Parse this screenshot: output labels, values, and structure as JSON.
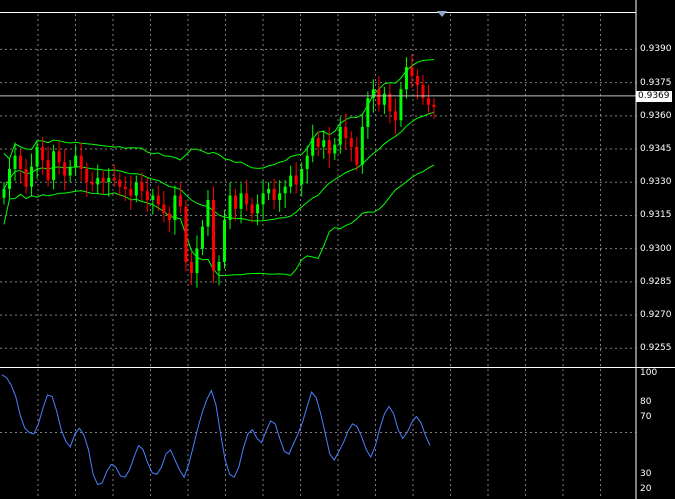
{
  "chart_data": [
    {
      "type": "candlestick",
      "indicators": [
        "bollinger-bands"
      ],
      "y_ticks": [
        "0.9390",
        "0.9375",
        "0.9360",
        "0.9345",
        "0.9330",
        "0.9315",
        "0.9300",
        "0.9285",
        "0.9270",
        "0.9255"
      ],
      "ylim": [
        0.9247,
        0.9406
      ],
      "current_price": "0.9369",
      "grid": true,
      "colors": {
        "bull": "#00ff00",
        "bear": "#ff0000",
        "bands": "#00ff00",
        "grid": "#7f7f7f",
        "price_line": "#c0c0c0"
      },
      "candles_close": [
        0.9327,
        0.9336,
        0.9342,
        0.9336,
        0.9328,
        0.9337,
        0.9346,
        0.934,
        0.9331,
        0.9344,
        0.9339,
        0.9333,
        0.9337,
        0.9342,
        0.9336,
        0.933,
        0.9329,
        0.9332,
        0.933,
        0.9332,
        0.9331,
        0.9328,
        0.9327,
        0.9324,
        0.933,
        0.9326,
        0.9322,
        0.9324,
        0.932,
        0.9316,
        0.9313,
        0.9324,
        0.9319,
        0.9294,
        0.9289,
        0.93,
        0.931,
        0.9322,
        0.929,
        0.9294,
        0.9313,
        0.9324,
        0.9318,
        0.9325,
        0.932,
        0.9316,
        0.932,
        0.9325,
        0.9327,
        0.9322,
        0.9325,
        0.9328,
        0.9333,
        0.9329,
        0.9336,
        0.9342,
        0.935,
        0.9346,
        0.9349,
        0.9343,
        0.9347,
        0.9355,
        0.935,
        0.9346,
        0.9338,
        0.9355,
        0.9368,
        0.9372,
        0.9365,
        0.937,
        0.9362,
        0.9358,
        0.9372,
        0.9382,
        0.9378,
        0.9374,
        0.9368,
        0.9365,
        0.9364
      ]
    },
    {
      "type": "line",
      "y_ticks": [
        "100",
        "80",
        "70",
        "30",
        "20"
      ],
      "ylim": [
        15,
        103
      ],
      "colors": {
        "line": "#4a7fff"
      },
      "values": [
        99,
        97,
        92,
        84,
        71,
        62,
        59,
        58,
        65,
        76,
        85,
        84,
        74,
        61,
        53,
        49,
        58,
        62,
        57,
        47,
        30,
        23,
        24,
        32,
        37,
        35,
        29,
        28,
        33,
        42,
        50,
        47,
        38,
        31,
        30,
        35,
        44,
        47,
        40,
        33,
        28,
        37,
        49,
        62,
        73,
        82,
        88,
        78,
        58,
        40,
        30,
        28,
        35,
        48,
        58,
        61,
        55,
        52,
        60,
        67,
        65,
        55,
        46,
        44,
        51,
        58,
        66,
        77,
        87,
        83,
        72,
        58,
        44,
        40,
        46,
        52,
        60,
        65,
        63,
        56,
        47,
        42,
        50,
        62,
        72,
        77,
        72,
        61,
        55,
        59,
        66,
        70,
        66,
        57,
        50
      ]
    }
  ]
}
